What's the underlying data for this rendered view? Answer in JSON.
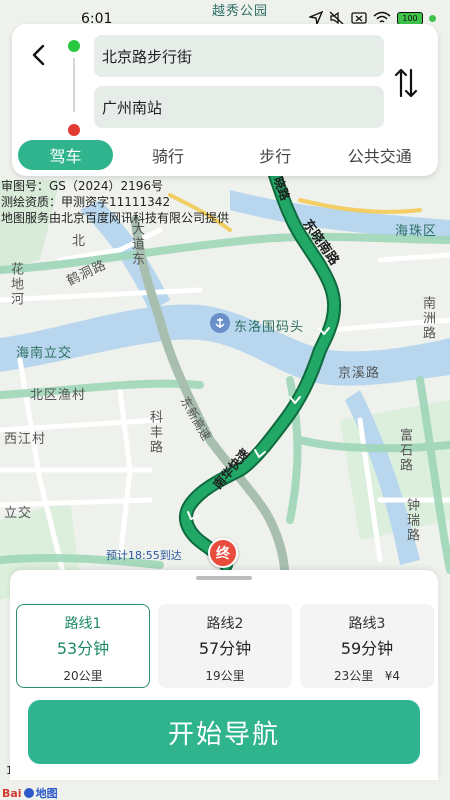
{
  "status_bar": {
    "time": "6:01",
    "battery": "100"
  },
  "search": {
    "start": "北京路步行街",
    "end": "广州南站"
  },
  "tabs": [
    {
      "label": "驾车",
      "active": true
    },
    {
      "label": "骑行",
      "active": false
    },
    {
      "label": "步行",
      "active": false
    },
    {
      "label": "公共交通",
      "active": false
    }
  ],
  "map": {
    "copyright": "审图号：GS（2024）2196号\n测绘资质：甲测资字11111342\n地图服务由北京百度网讯科技有限公司提供",
    "labels": {
      "yuexiu_park": "越秀公园",
      "haizhu": "海珠区",
      "dongluo": "东洛围码头",
      "hainan_lijiao": "海南立交",
      "beiqu": "北区渔村",
      "xijiao": "西江村",
      "lijiao": "立交",
      "jingtang": "京溪路",
      "fuxi": "富石路",
      "keyong": "科丰路",
      "hedong": "鹤洞路",
      "dadao": "大道东",
      "zhongsheng": "钟瑞路",
      "huadi": "花地河",
      "nan": "南洲路",
      "bei": "北"
    },
    "roads": {
      "dongxiao": "东晓南路",
      "nanhua": "南华快速",
      "dongxin": "东新高速",
      "top_road": "晓路"
    },
    "eta": "预计18:55到达",
    "end_marker": "终",
    "scale": "1",
    "baidu": "地图"
  },
  "routes": [
    {
      "name": "路线1",
      "time": "53分钟",
      "detail": "20公里",
      "selected": true
    },
    {
      "name": "路线2",
      "time": "57分钟",
      "detail": "19公里",
      "selected": false
    },
    {
      "name": "路线3",
      "time": "59分钟",
      "detail": "23公里   ¥4",
      "selected": false
    }
  ],
  "start_button": "开始导航",
  "colors": {
    "accent": "#2fb48e",
    "route": "#1d9b62",
    "start_dot": "#28c940",
    "end_dot": "#e53935"
  }
}
